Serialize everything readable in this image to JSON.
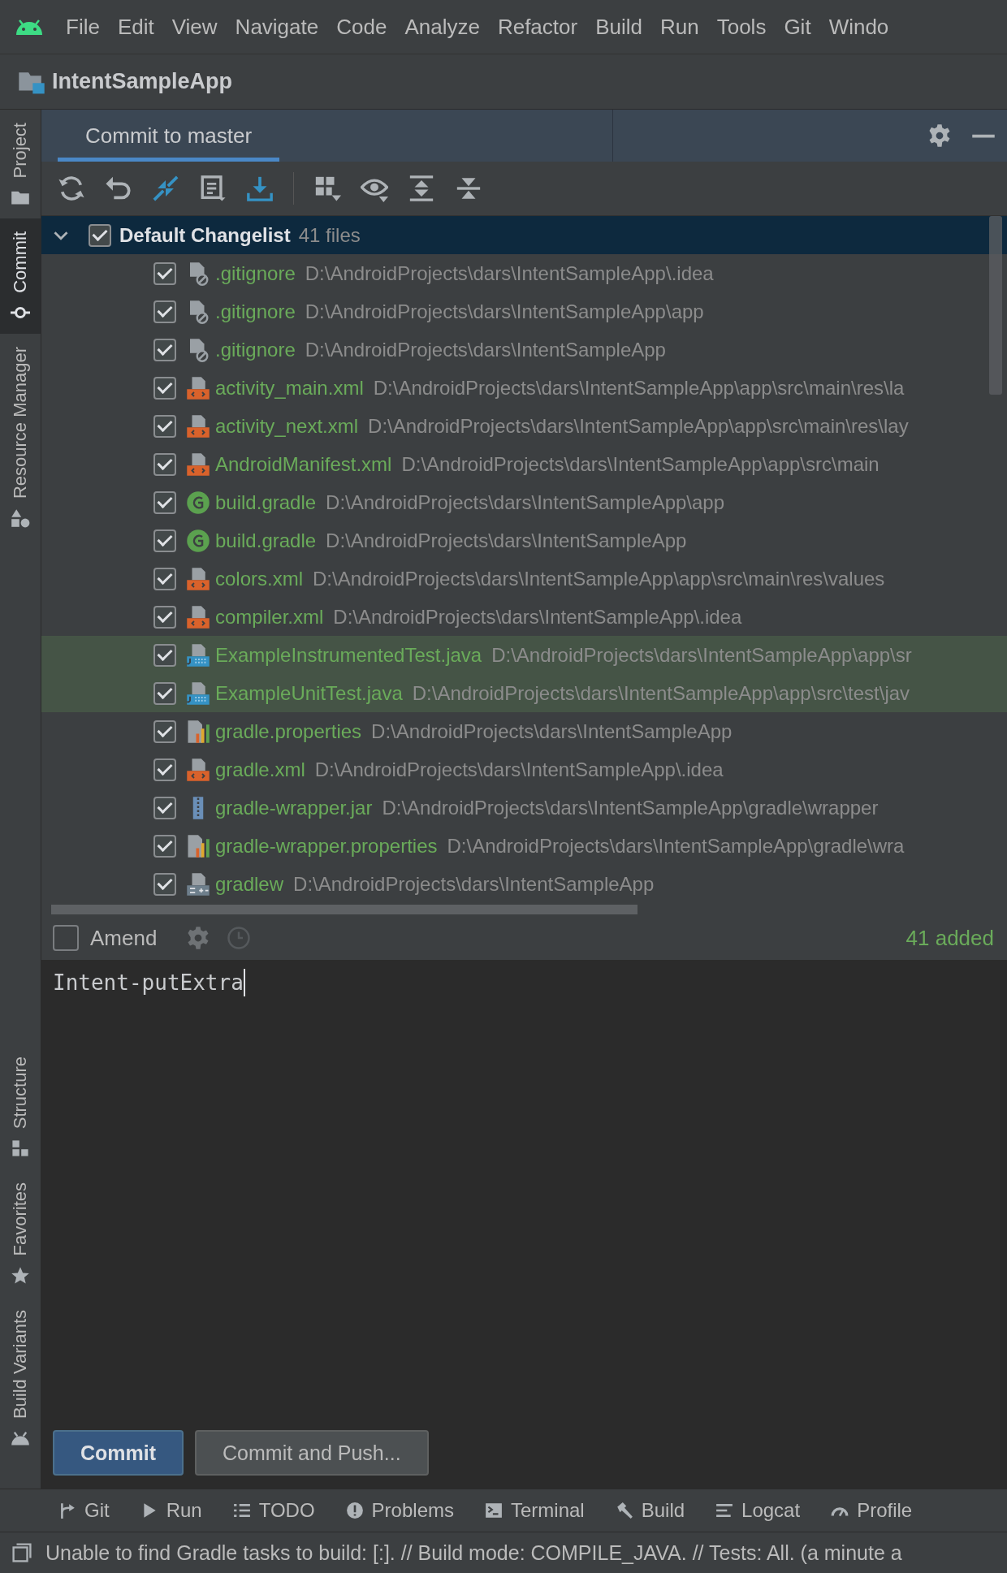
{
  "menu": [
    "File",
    "Edit",
    "View",
    "Navigate",
    "Code",
    "Analyze",
    "Refactor",
    "Build",
    "Run",
    "Tools",
    "Git",
    "Windo"
  ],
  "project": {
    "name": "IntentSampleApp"
  },
  "side_tabs_top": [
    {
      "label": "Project",
      "selected": false,
      "kind": "folder"
    },
    {
      "label": "Commit",
      "selected": true,
      "kind": "commit"
    },
    {
      "label": "Resource Manager",
      "selected": false,
      "kind": "shapes"
    }
  ],
  "side_tabs_bottom": [
    {
      "label": "Structure",
      "selected": false,
      "kind": "structure"
    },
    {
      "label": "Favorites",
      "selected": false,
      "kind": "star"
    },
    {
      "label": "Build Variants",
      "selected": false,
      "kind": "android"
    }
  ],
  "tab": {
    "label": "Commit to master",
    "selected": true
  },
  "changelist": {
    "name": "Default Changelist",
    "count": "41 files",
    "checked": true,
    "expanded": true
  },
  "files": [
    {
      "name": ".gitignore",
      "path": "D:\\AndroidProjects\\dars\\IntentSampleApp\\.idea",
      "kind": "ignore",
      "checked": true,
      "highlighted": false
    },
    {
      "name": ".gitignore",
      "path": "D:\\AndroidProjects\\dars\\IntentSampleApp\\app",
      "kind": "ignore",
      "checked": true,
      "highlighted": false
    },
    {
      "name": ".gitignore",
      "path": "D:\\AndroidProjects\\dars\\IntentSampleApp",
      "kind": "ignore",
      "checked": true,
      "highlighted": false
    },
    {
      "name": "activity_main.xml",
      "path": "D:\\AndroidProjects\\dars\\IntentSampleApp\\app\\src\\main\\res\\la",
      "kind": "xml",
      "checked": true,
      "highlighted": false
    },
    {
      "name": "activity_next.xml",
      "path": "D:\\AndroidProjects\\dars\\IntentSampleApp\\app\\src\\main\\res\\lay",
      "kind": "xml",
      "checked": true,
      "highlighted": false
    },
    {
      "name": "AndroidManifest.xml",
      "path": "D:\\AndroidProjects\\dars\\IntentSampleApp\\app\\src\\main",
      "kind": "xml",
      "checked": true,
      "highlighted": false
    },
    {
      "name": "build.gradle",
      "path": "D:\\AndroidProjects\\dars\\IntentSampleApp\\app",
      "kind": "gradle",
      "checked": true,
      "highlighted": false
    },
    {
      "name": "build.gradle",
      "path": "D:\\AndroidProjects\\dars\\IntentSampleApp",
      "kind": "gradle",
      "checked": true,
      "highlighted": false
    },
    {
      "name": "colors.xml",
      "path": "D:\\AndroidProjects\\dars\\IntentSampleApp\\app\\src\\main\\res\\values",
      "kind": "xml",
      "checked": true,
      "highlighted": false
    },
    {
      "name": "compiler.xml",
      "path": "D:\\AndroidProjects\\dars\\IntentSampleApp\\.idea",
      "kind": "xml",
      "checked": true,
      "highlighted": false
    },
    {
      "name": "ExampleInstrumentedTest.java",
      "path": "D:\\AndroidProjects\\dars\\IntentSampleApp\\app\\sr",
      "kind": "java",
      "checked": true,
      "highlighted": true
    },
    {
      "name": "ExampleUnitTest.java",
      "path": "D:\\AndroidProjects\\dars\\IntentSampleApp\\app\\src\\test\\jav",
      "kind": "java",
      "checked": true,
      "highlighted": true
    },
    {
      "name": "gradle.properties",
      "path": "D:\\AndroidProjects\\dars\\IntentSampleApp",
      "kind": "properties",
      "checked": true,
      "highlighted": false
    },
    {
      "name": "gradle.xml",
      "path": "D:\\AndroidProjects\\dars\\IntentSampleApp\\.idea",
      "kind": "xml",
      "checked": true,
      "highlighted": false
    },
    {
      "name": "gradle-wrapper.jar",
      "path": "D:\\AndroidProjects\\dars\\IntentSampleApp\\gradle\\wrapper",
      "kind": "jar",
      "checked": true,
      "highlighted": false
    },
    {
      "name": "gradle-wrapper.properties",
      "path": "D:\\AndroidProjects\\dars\\IntentSampleApp\\gradle\\wra",
      "kind": "properties",
      "checked": true,
      "highlighted": false
    },
    {
      "name": "gradlew",
      "path": "D:\\AndroidProjects\\dars\\IntentSampleApp",
      "kind": "shell",
      "checked": true,
      "highlighted": false
    }
  ],
  "amend": {
    "label": "Amend",
    "checked": false
  },
  "summary": "41 added",
  "message": "Intent-putExtra",
  "buttons": [
    {
      "label": "Commit",
      "kind": "primary"
    },
    {
      "label": "Commit and Push...",
      "kind": "secondary"
    }
  ],
  "tool_tabs": [
    {
      "label": "Git",
      "kind": "git"
    },
    {
      "label": "Run",
      "kind": "run"
    },
    {
      "label": "TODO",
      "kind": "list"
    },
    {
      "label": "Problems",
      "kind": "problems"
    },
    {
      "label": "Terminal",
      "kind": "terminal"
    },
    {
      "label": "Build",
      "kind": "hammer"
    },
    {
      "label": "Logcat",
      "kind": "logcat"
    },
    {
      "label": "Profile",
      "kind": "gauge"
    }
  ],
  "status_bar": "Unable to find Gradle tasks to build: [:]. // Build mode: COMPILE_JAVA. // Tests: All. (a minute a"
}
